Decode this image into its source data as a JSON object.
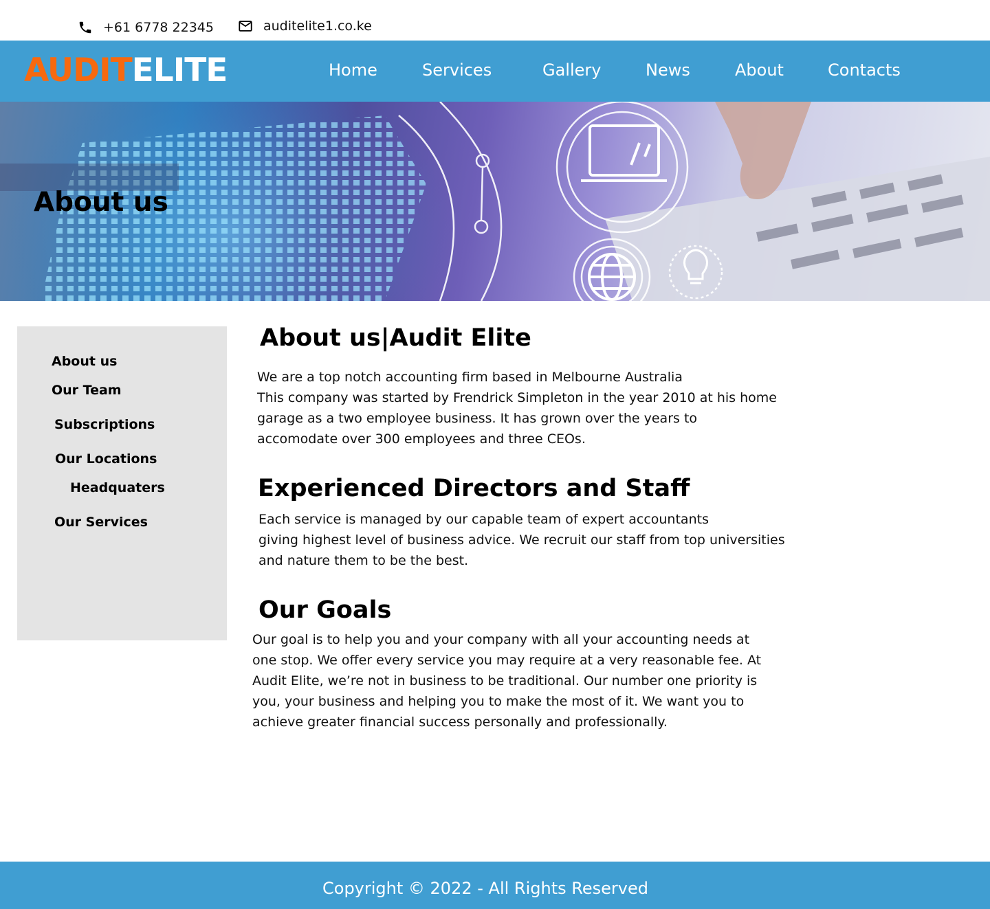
{
  "contact": {
    "phone": "+61 6778 22345",
    "email": "auditelite1.co.ke"
  },
  "brand": {
    "part1": "AUDIT",
    "part2": "ELITE",
    "accent_color": "#f7690f",
    "header_color": "#409ed2"
  },
  "nav": {
    "home": "Home",
    "services": "Services",
    "gallery": "Gallery",
    "news": "News",
    "about": "About",
    "contacts": "Contacts"
  },
  "hero": {
    "title": "About us"
  },
  "sidebar": {
    "items": [
      "About us",
      "Our Team",
      "Subscriptions",
      "Our Locations",
      "Headquaters",
      "Our Services"
    ]
  },
  "main": {
    "section1": {
      "heading": "About us|Audit Elite",
      "lines": [
        "We are a top notch accounting firm based in Melbourne Australia",
        "This company was started by Frendrick Simpleton in the year 2010 at his home",
        "garage as a two employee business. It has grown over the years to",
        "accomodate over 300 employees and three CEOs."
      ]
    },
    "section2": {
      "heading": "Experienced Directors and Staff",
      "lines": [
        "Each service is managed  by our capable team of expert accountants",
        "giving highest level of business advice. We recruit our staff from top universities",
        "and nature them to be the best."
      ]
    },
    "section3": {
      "heading": "Our Goals",
      "lines": [
        "Our goal is to help you and your company with all your accounting needs at",
        "one stop. We offer every service you may require at a very reasonable fee. At",
        "Audit Elite, we’re not in business to be traditional. Our number one priority is",
        "you, your business and helping you to make the most of it. We want you to",
        "achieve greater financial success personally and professionally."
      ]
    }
  },
  "footer": {
    "copyright": "Copyright © 2022 - All Rights Reserved"
  }
}
